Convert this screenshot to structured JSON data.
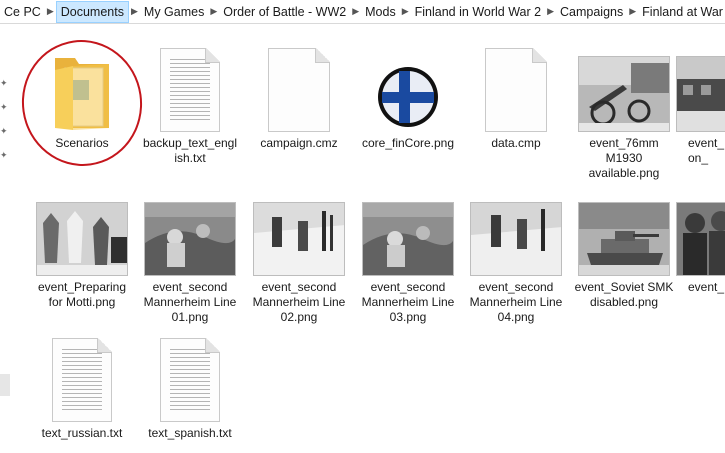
{
  "breadcrumb": {
    "items": [
      "Ce PC",
      "Documents",
      "My Games",
      "Order of Battle - WW2",
      "Mods",
      "Finland in World War 2",
      "Campaigns",
      "Finland at War"
    ]
  },
  "files": [
    {
      "name": "Scenarios",
      "type": "folder"
    },
    {
      "name": "backup_text_english.txt",
      "type": "text"
    },
    {
      "name": "campaign.cmz",
      "type": "blank"
    },
    {
      "name": "core_finCore.png",
      "type": "finland-roundel"
    },
    {
      "name": "data.cmp",
      "type": "blank"
    },
    {
      "name": "event_76mm M1930 available.png",
      "type": "photo"
    },
    {
      "name": "event_...on_...",
      "type": "photo"
    },
    {
      "name": "event_Preparing for Motti.png",
      "type": "photo"
    },
    {
      "name": "event_second Mannerheim Line 01.png",
      "type": "photo"
    },
    {
      "name": "event_second Mannerheim Line 02.png",
      "type": "photo"
    },
    {
      "name": "event_second Mannerheim Line 03.png",
      "type": "photo"
    },
    {
      "name": "event_second Mannerheim Line 04.png",
      "type": "photo"
    },
    {
      "name": "event_Soviet SMK disabled.png",
      "type": "photo"
    },
    {
      "name": "event_...e...",
      "type": "photo"
    },
    {
      "name": "text_russian.txt",
      "type": "text"
    },
    {
      "name": "text_spanish.txt",
      "type": "text"
    }
  ],
  "labels": {
    "f0": "Scenarios",
    "f1": "backup_text_engl ish.txt",
    "f2": "campaign.cmz",
    "f3": "core_finCore.png",
    "f4": "data.cmp",
    "f5": "event_76mm M1930 available.png",
    "f6": "event_ on_",
    "f7": "event_Preparing for Motti.png",
    "f8": "event_second Mannerheim Line 01.png",
    "f9": "event_second Mannerheim Line 02.png",
    "f10": "event_second Mannerheim Line 03.png",
    "f11": "event_second Mannerheim Line 04.png",
    "f12": "event_Soviet SMK disabled.png",
    "f13": "event_ e",
    "f14": "text_russian.txt",
    "f15": "text_spanish.txt"
  },
  "colors": {
    "selection": "#cce8ff",
    "annotation": "#c4161c",
    "folder": "#f5c84c",
    "finland_blue": "#1a4aa0"
  }
}
